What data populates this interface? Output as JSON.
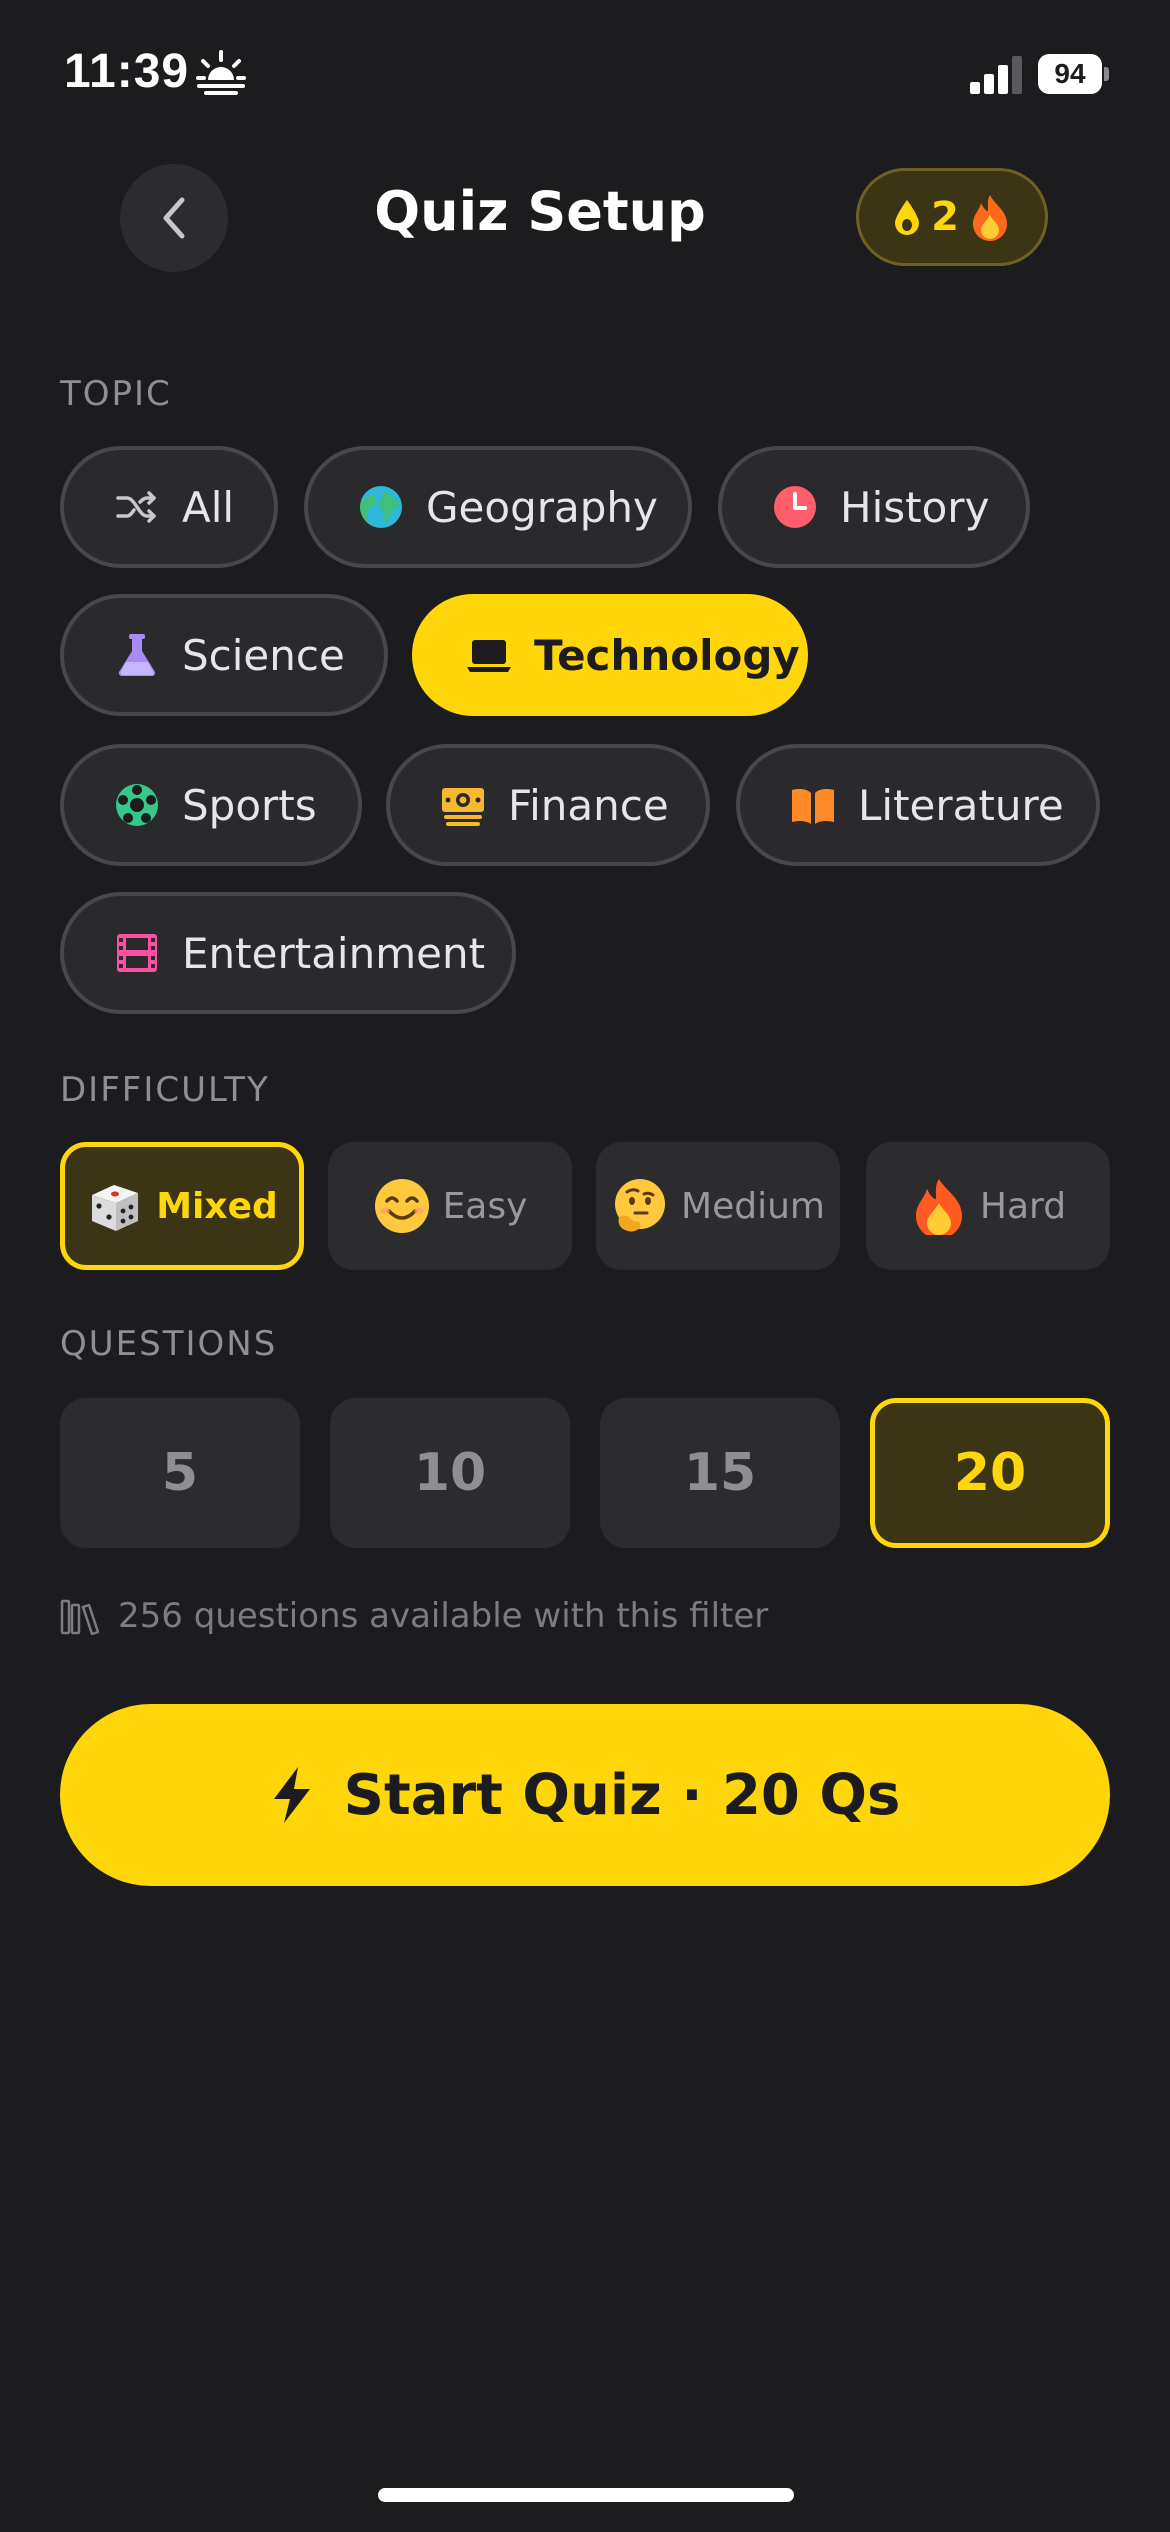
{
  "status_bar": {
    "time": "11:39",
    "battery": "94",
    "icons": [
      "sunrise-icon",
      "signal-icon",
      "battery-icon"
    ]
  },
  "header": {
    "title": "Quiz Setup",
    "streak_count": "2",
    "icons": [
      "back-chevron-icon",
      "drop-icon",
      "fire-icon"
    ]
  },
  "topic": {
    "label": "TOPIC",
    "items": [
      {
        "label": "All",
        "icon": "shuffle-icon"
      },
      {
        "label": "Geography",
        "icon": "globe-icon"
      },
      {
        "label": "History",
        "icon": "clock-icon"
      },
      {
        "label": "Science",
        "icon": "flask-icon"
      },
      {
        "label": "Technology",
        "icon": "laptop-icon",
        "selected": true
      },
      {
        "label": "Sports",
        "icon": "soccer-ball-icon"
      },
      {
        "label": "Finance",
        "icon": "money-icon"
      },
      {
        "label": "Literature",
        "icon": "book-icon"
      },
      {
        "label": "Entertainment",
        "icon": "film-icon"
      }
    ]
  },
  "difficulty": {
    "label": "DIFFICULTY",
    "items": [
      {
        "label": "Mixed",
        "icon": "dice-icon",
        "selected": true
      },
      {
        "label": "Easy",
        "icon": "smile-icon"
      },
      {
        "label": "Medium",
        "icon": "thinking-icon"
      },
      {
        "label": "Hard",
        "icon": "fire-icon"
      }
    ]
  },
  "questions": {
    "label": "QUESTIONS",
    "items": [
      {
        "label": "5"
      },
      {
        "label": "10"
      },
      {
        "label": "15"
      },
      {
        "label": "20",
        "selected": true
      }
    ]
  },
  "available_note": "256 questions available with this filter",
  "start_button": "Start Quiz · 20 Qs",
  "colors": {
    "background": "#1c1c1e",
    "accent": "#ffd60a",
    "card": "#2c2c2e",
    "muted": "#8e8e93"
  }
}
